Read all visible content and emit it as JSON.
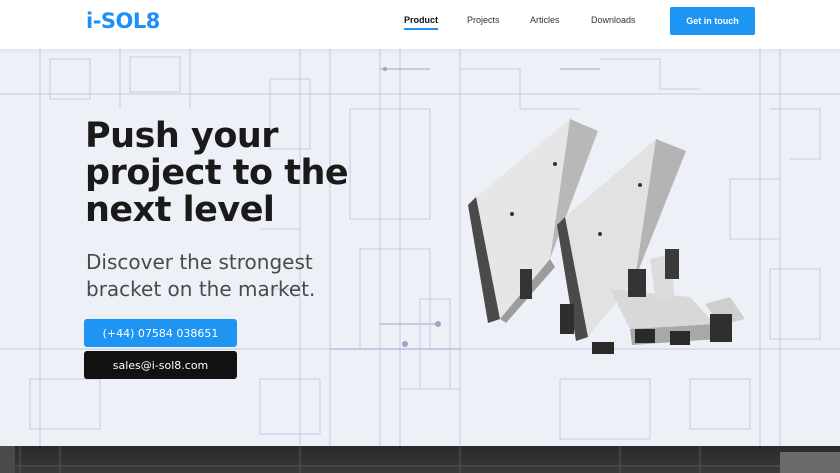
{
  "header": {
    "logo_text": "i-SOL8",
    "nav": [
      {
        "label": "Product",
        "active": true
      },
      {
        "label": "Projects",
        "active": false
      },
      {
        "label": "Articles",
        "active": false
      },
      {
        "label": "Downloads",
        "active": false
      }
    ],
    "cta_label": "Get in touch"
  },
  "hero": {
    "headline": "Push your project to the next level",
    "subline": "Discover the strongest bracket on the market.",
    "phone_label": "(+44) 07584 038651",
    "email_label": "sales@i-sol8.com"
  },
  "colors": {
    "accent": "#1e95f3",
    "dark_button": "#111111",
    "background": "#eef0f8"
  }
}
